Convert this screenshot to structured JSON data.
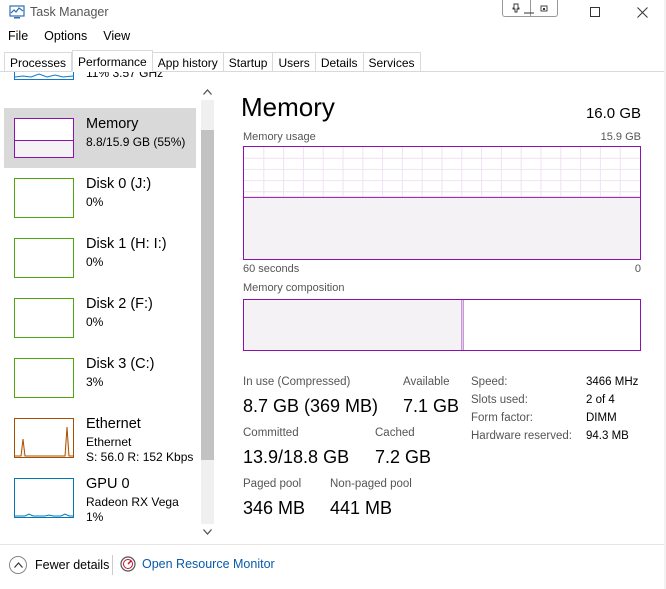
{
  "window": {
    "title": "Task Manager"
  },
  "menu": [
    "File",
    "Options",
    "View"
  ],
  "tabs": [
    "Processes",
    "Performance",
    "App history",
    "Startup",
    "Users",
    "Details",
    "Services"
  ],
  "active_tab": "Performance",
  "sidebar": {
    "partial_top_text": "11%  3.57 GHz",
    "items": [
      {
        "name": "Memory",
        "sub1": "8.8/15.9 GB (55%)",
        "sub2": "",
        "color": "#8b12ae",
        "selected": true
      },
      {
        "name": "Disk 0 (J:)",
        "sub1": "0%",
        "sub2": "",
        "color": "#4da60c",
        "selected": false
      },
      {
        "name": "Disk 1 (H: I:)",
        "sub1": "0%",
        "sub2": "",
        "color": "#4da60c",
        "selected": false
      },
      {
        "name": "Disk 2 (F:)",
        "sub1": "0%",
        "sub2": "",
        "color": "#4da60c",
        "selected": false
      },
      {
        "name": "Disk 3 (C:)",
        "sub1": "3%",
        "sub2": "",
        "color": "#4da60c",
        "selected": false
      },
      {
        "name": "Ethernet",
        "sub1": "Ethernet",
        "sub2": "S: 56.0  R: 152 Kbps",
        "color": "#a74f01",
        "selected": false
      },
      {
        "name": "GPU 0",
        "sub1": "Radeon RX Vega",
        "sub2": "1%",
        "color": "#0078b6",
        "selected": false
      }
    ]
  },
  "main": {
    "title": "Memory",
    "total": "16.0 GB",
    "usage_label": "Memory usage",
    "usage_max": "15.9 GB",
    "time_left": "60 seconds",
    "time_right": "0",
    "composition_label": "Memory composition",
    "usage_level": 0.55,
    "composition_split": 0.55,
    "stats": {
      "in_use_label": "In use (Compressed)",
      "in_use_value": "8.7 GB (369 MB)",
      "available_label": "Available",
      "available_value": "7.1 GB",
      "committed_label": "Committed",
      "committed_value": "13.9/18.8 GB",
      "cached_label": "Cached",
      "cached_value": "7.2 GB",
      "paged_label": "Paged pool",
      "paged_value": "346 MB",
      "nonpaged_label": "Non-paged pool",
      "nonpaged_value": "441 MB"
    },
    "specs": [
      {
        "key": "Speed:",
        "value": "3466 MHz"
      },
      {
        "key": "Slots used:",
        "value": "2 of 4"
      },
      {
        "key": "Form factor:",
        "value": "DIMM"
      },
      {
        "key": "Hardware reserved:",
        "value": "94.3 MB"
      }
    ]
  },
  "footer": {
    "fewer_details": "Fewer details",
    "open_resource_monitor": "Open Resource Monitor"
  },
  "colors": {
    "memory": "#8b12ae",
    "disk": "#4da60c",
    "ethernet": "#a74f01",
    "gpu": "#0078b6",
    "link": "#0a5aa8"
  }
}
